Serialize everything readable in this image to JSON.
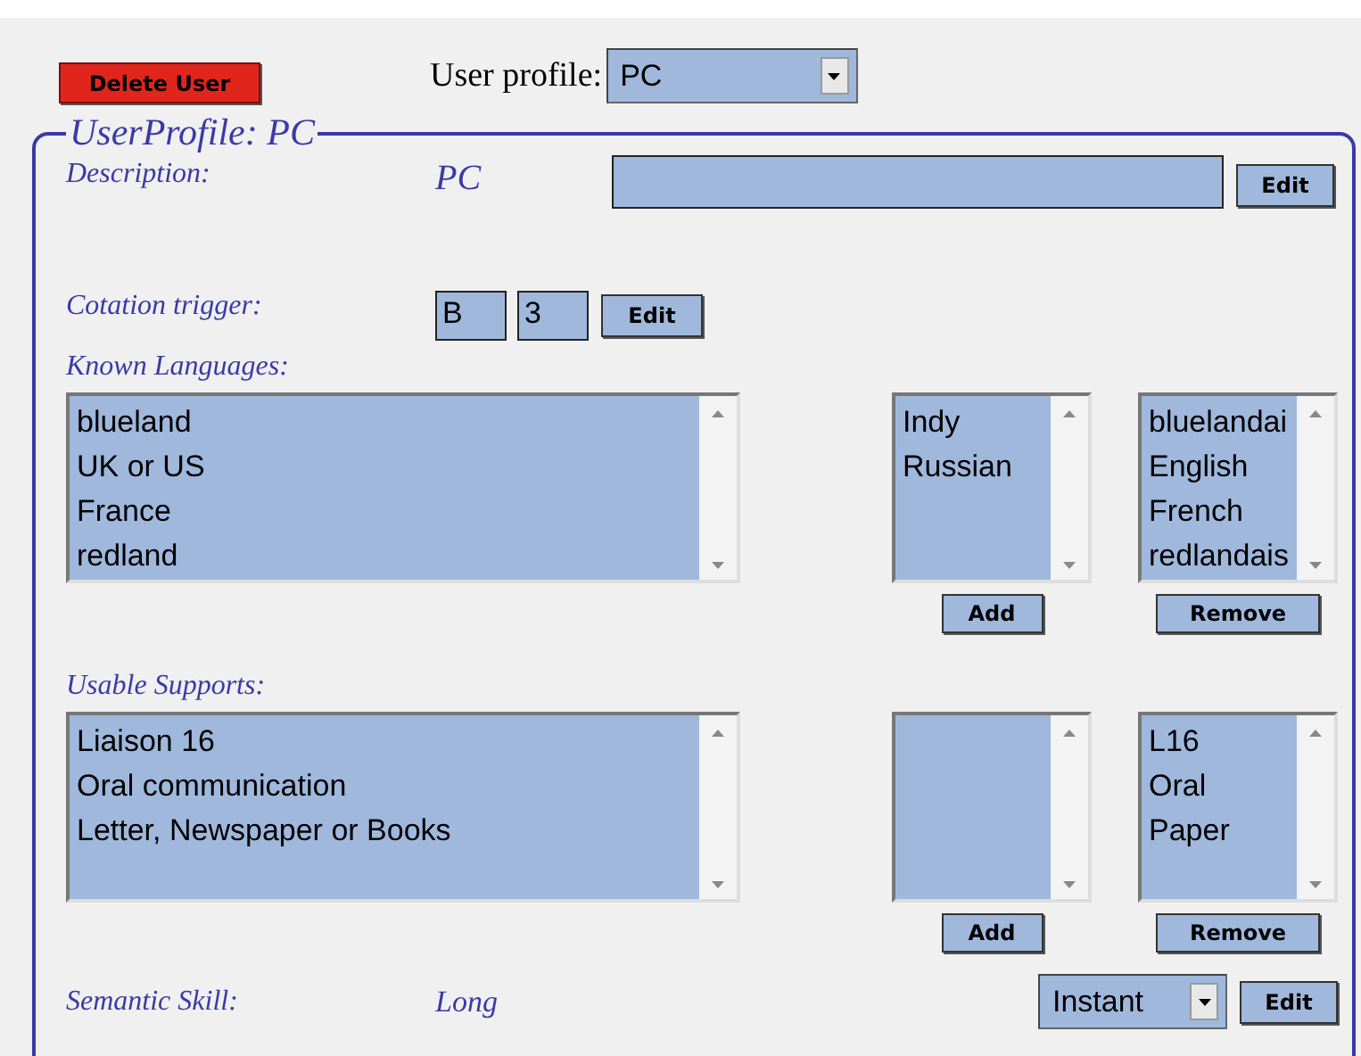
{
  "header": {
    "delete_button": "Delete User",
    "profile_label": "User profile:",
    "profile_select": "PC"
  },
  "profile": {
    "legend": "UserProfile: PC",
    "description": {
      "label": "Description:",
      "value": "PC",
      "edit": "Edit"
    },
    "cotation": {
      "label": "Cotation trigger:",
      "fields": [
        "B",
        "3"
      ],
      "edit": "Edit"
    },
    "sections": [
      {
        "label": "Known Languages:",
        "main_list": [
          "blueland",
          "UK or US",
          "France",
          "redland"
        ],
        "available_list": [
          "Indy",
          "Russian"
        ],
        "add": "Add",
        "chosen_list": [
          "bluelandai",
          "English",
          "French",
          "redlandais"
        ],
        "remove": "Remove"
      },
      {
        "label": "Usable Supports:",
        "main_list": [
          "Liaison 16",
          "Oral communication",
          "Letter, Newspaper or Books"
        ],
        "add": "Add",
        "chosen_list": [
          "L16",
          "Oral",
          "Paper"
        ],
        "remove": "Remove"
      }
    ],
    "semantic": {
      "label": "Semantic Skill:",
      "value": "Long",
      "select": "Instant",
      "edit": "Edit"
    }
  }
}
